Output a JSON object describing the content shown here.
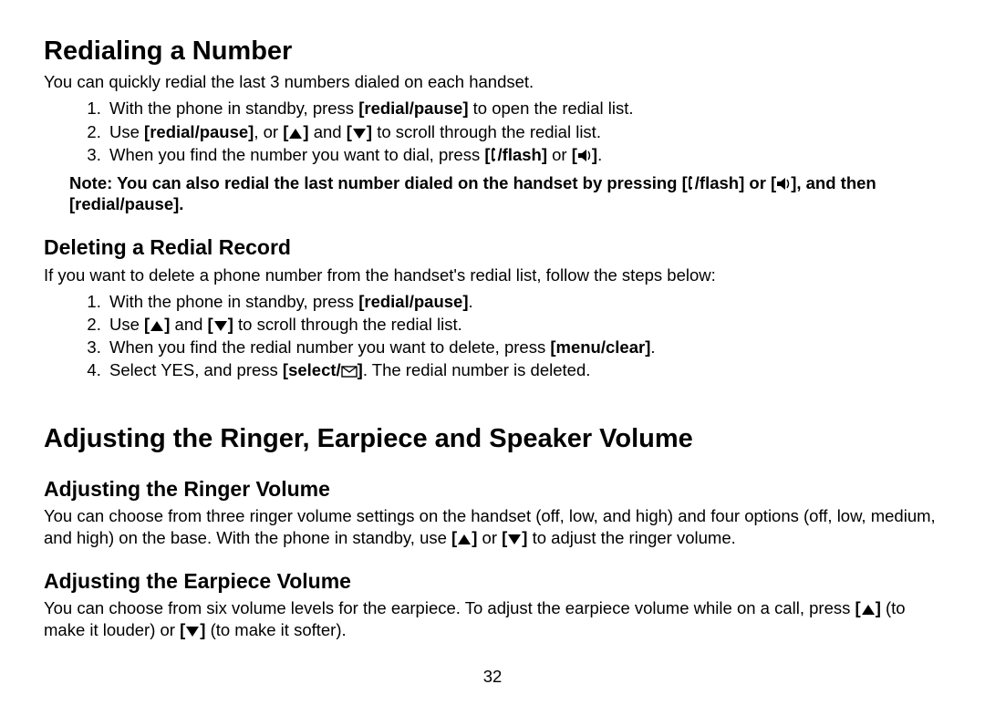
{
  "section1": {
    "heading": "Redialing a Number",
    "intro": "You can quickly redial the last 3 numbers dialed on each handset.",
    "step1_a": "With the phone in standby, press ",
    "step1_b": "[redial/pause]",
    "step1_c": " to open the redial list.",
    "step2_a": "Use ",
    "step2_b": "[redial/pause]",
    "step2_c": ", or ",
    "step2_d": " and ",
    "step2_e": " to scroll through the redial list.",
    "step3_a": "When you find the number you want to dial, press ",
    "step3_b": "/flash]",
    "step3_c": " or ",
    "step3_d": ".",
    "note_a": "Note: You can also redial the last number dialed on the handset by pressing [",
    "note_b": "/flash] or [",
    "note_c": "], and then [redial/pause]."
  },
  "section2": {
    "heading": "Deleting a Redial Record",
    "intro": "If you want to delete a phone number from the handset's redial list, follow the steps below:",
    "step1_a": "With the phone in standby, press ",
    "step1_b": "[redial/pause]",
    "step1_c": ".",
    "step2_a": "Use ",
    "step2_b": " and ",
    "step2_c": " to scroll through the redial list.",
    "step3_a": "When you find the redial number you want to delete, press ",
    "step3_b": "[menu/clear]",
    "step3_c": ".",
    "step4_a": "Select YES, and press ",
    "step4_b": "[select/",
    "step4_c": "]",
    "step4_d": ". The redial number is deleted."
  },
  "section3": {
    "heading": "Adjusting the Ringer, Earpiece and Speaker Volume",
    "sub1_heading": "Adjusting the Ringer Volume",
    "sub1_body_a": "You can choose from three ringer volume settings on the handset (off, low, and high) and four options (off, low, medium, and high) on the base. With the phone in standby, use ",
    "sub1_body_b": " or ",
    "sub1_body_c": " to adjust the ringer volume.",
    "sub2_heading": "Adjusting the Earpiece Volume",
    "sub2_body_a": "You can choose from six volume levels for the earpiece. To adjust the earpiece volume while on a call, press ",
    "sub2_body_b": " (to make it louder) or ",
    "sub2_body_c": " (to make it softer)."
  },
  "page_number": "32"
}
